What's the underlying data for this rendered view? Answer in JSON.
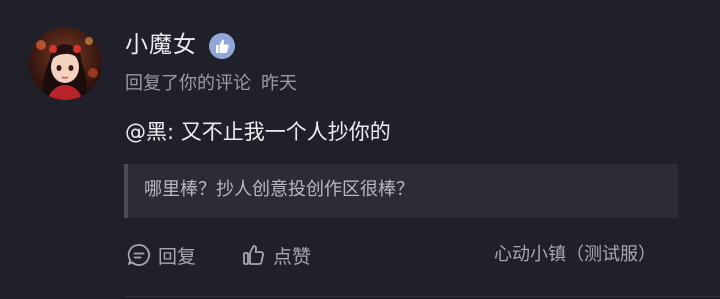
{
  "notification": {
    "username": "小魔女",
    "verified_badge": "thumbs-up-badge-icon",
    "action_text": "回复了你的评论",
    "time": "昨天",
    "comment_text": "@黑: 又不止我一个人抄你的",
    "quoted_comment": "哪里棒？抄人创意投创作区很棒？",
    "actions": {
      "reply_label": "回复",
      "like_label": "点赞"
    },
    "source": "心动小镇（测试服）"
  },
  "colors": {
    "background": "#1f2029",
    "quote_background": "#2b2c36",
    "badge": "#8fa8d8",
    "muted_text": "#9a9ba6"
  }
}
